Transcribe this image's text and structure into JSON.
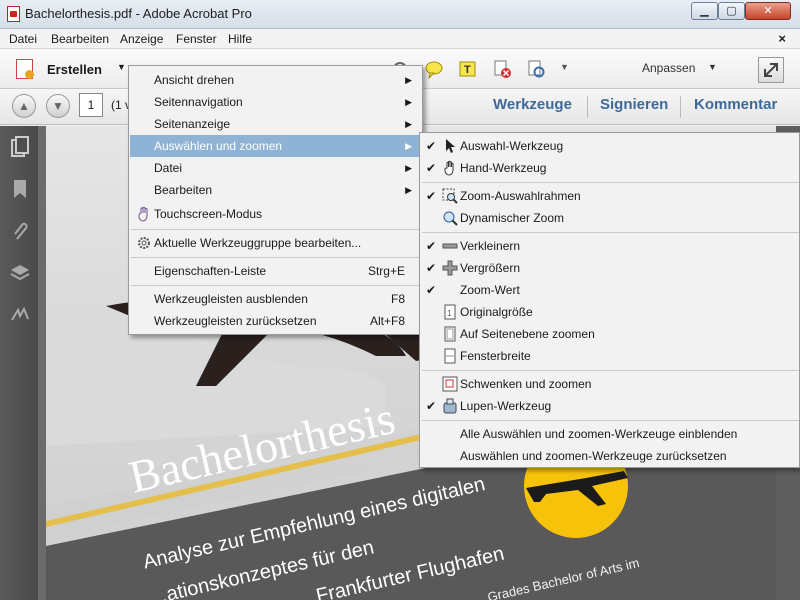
{
  "window": {
    "title": "Bachelorthesis.pdf - Adobe Acrobat Pro"
  },
  "menubar": [
    "Datei",
    "Bearbeiten",
    "Anzeige",
    "Fenster",
    "Hilfe"
  ],
  "toolbar": {
    "erstellen": "Erstellen",
    "anpassen": "Anpassen"
  },
  "nav": {
    "page_value": "1",
    "page_count_partial": "(1 v"
  },
  "right_tabs": [
    "Werkzeuge",
    "Signieren",
    "Kommentar"
  ],
  "menu1": [
    {
      "label": "Ansicht drehen",
      "submenu": true
    },
    {
      "label": "Seitennavigation",
      "submenu": true
    },
    {
      "label": "Seitenanzeige",
      "submenu": true
    },
    {
      "label": "Auswählen und zoomen",
      "submenu": true,
      "highlighted": true
    },
    {
      "label": "Datei",
      "submenu": true
    },
    {
      "label": "Bearbeiten",
      "submenu": true
    },
    {
      "label": "Touchscreen-Modus",
      "icon": "hand-touch-icon"
    },
    {
      "label": "Aktuelle Werkzeuggruppe bearbeiten...",
      "icon": "gear-icon"
    },
    {
      "label": "Eigenschaften-Leiste",
      "shortcut": "Strg+E"
    },
    {
      "label": "Werkzeugleisten ausblenden",
      "shortcut": "F8"
    },
    {
      "label": "Werkzeugleisten zurücksetzen",
      "shortcut": "Alt+F8"
    }
  ],
  "menu2": [
    {
      "label": "Auswahl-Werkzeug",
      "checked": true,
      "icon": "cursor-arrow-icon"
    },
    {
      "label": "Hand-Werkzeug",
      "checked": true,
      "icon": "hand-icon"
    },
    {
      "label": "Zoom-Auswahlrahmen",
      "checked": true,
      "icon": "zoom-marquee-icon"
    },
    {
      "label": "Dynamischer Zoom",
      "checked": false,
      "icon": "dynamic-zoom-icon"
    },
    {
      "label": "Verkleinern",
      "checked": true,
      "icon": "minus-icon"
    },
    {
      "label": "Vergrößern",
      "checked": true,
      "icon": "plus-icon"
    },
    {
      "label": "Zoom-Wert",
      "checked": true,
      "icon": ""
    },
    {
      "label": "Originalgröße",
      "checked": false,
      "icon": "page-icon"
    },
    {
      "label": "Auf Seitenebene zoomen",
      "checked": false,
      "icon": "fit-page-icon"
    },
    {
      "label": "Fensterbreite",
      "checked": false,
      "icon": "fit-width-icon"
    },
    {
      "label": "Schwenken und zoomen",
      "checked": false,
      "icon": "pan-zoom-icon"
    },
    {
      "label": "Lupen-Werkzeug",
      "checked": true,
      "icon": "loupe-icon"
    },
    {
      "label": "Alle Auswählen und zoomen-Werkzeuge einblenden",
      "checked": false,
      "icon": ""
    },
    {
      "label": "Auswählen und zoomen-Werkzeuge zurücksetzen",
      "checked": false,
      "icon": ""
    }
  ],
  "document": {
    "title": "Bachelorthesis",
    "subtitle_line1": "Analyse zur Empfehlung eines digitalen",
    "subtitle_line2": "...ationskonzeptes für den",
    "subtitle_line3": "Frankfurter Flughafen",
    "corner_text": "Grades Bachelor of Arts im",
    "accent_color": "#f2b705"
  }
}
